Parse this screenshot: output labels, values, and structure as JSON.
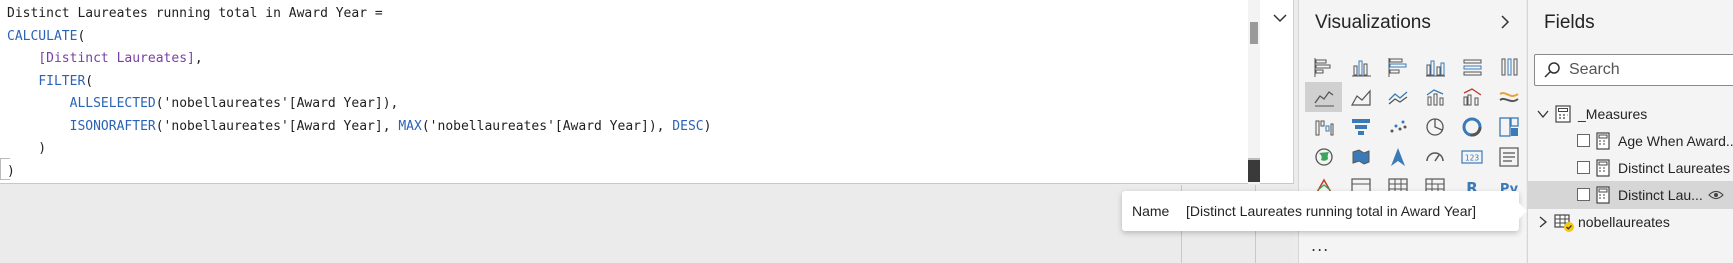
{
  "editor": {
    "lines": [
      [
        {
          "t": "Distinct Laureates running total in Award Year =",
          "c": "plain"
        }
      ],
      [
        {
          "t": "CALCULATE",
          "c": "kw"
        },
        {
          "t": "(",
          "c": "plain"
        }
      ],
      [
        {
          "t": "    ",
          "c": "plain"
        },
        {
          "t": "[Distinct Laureates]",
          "c": "ref"
        },
        {
          "t": ",",
          "c": "plain"
        }
      ],
      [
        {
          "t": "    ",
          "c": "plain"
        },
        {
          "t": "FILTER",
          "c": "kw"
        },
        {
          "t": "(",
          "c": "plain"
        }
      ],
      [
        {
          "t": "        ",
          "c": "plain"
        },
        {
          "t": "ALLSELECTED",
          "c": "kw"
        },
        {
          "t": "('nobellaureates'[Award Year]),",
          "c": "plain"
        }
      ],
      [
        {
          "t": "        ",
          "c": "plain"
        },
        {
          "t": "ISONORAFTER",
          "c": "kw"
        },
        {
          "t": "('nobellaureates'[Award Year], ",
          "c": "plain"
        },
        {
          "t": "MAX",
          "c": "kw"
        },
        {
          "t": "('nobellaureates'[Award Year]), ",
          "c": "plain"
        },
        {
          "t": "DESC",
          "c": "kw"
        },
        {
          "t": ")",
          "c": "plain"
        }
      ],
      [
        {
          "t": "    )",
          "c": "plain"
        }
      ],
      [
        {
          "t": ")",
          "c": "plain"
        }
      ]
    ]
  },
  "visualizations": {
    "title": "Visualizations",
    "more": "...",
    "icons": [
      "stacked-bar-chart-icon",
      "stacked-column-chart-icon",
      "clustered-bar-chart-icon",
      "clustered-column-chart-icon",
      "100-stacked-bar-chart-icon",
      "100-stacked-column-chart-icon",
      "line-chart-icon",
      "area-chart-icon",
      "stacked-area-chart-icon",
      "line-and-column-chart-icon",
      "line-and-clustered-column-chart-icon",
      "ribbon-chart-icon",
      "waterfall-chart-icon",
      "funnel-chart-icon",
      "scatter-chart-icon",
      "pie-chart-icon",
      "donut-chart-icon",
      "treemap-icon",
      "map-icon",
      "filled-map-icon",
      "azure-map-icon",
      "gauge-icon",
      "card-icon",
      "multi-row-card-icon",
      "kpi-icon",
      "slicer-icon",
      "table-icon",
      "matrix-icon",
      "r-script-visual-icon",
      "python-visual-icon"
    ],
    "selected_index": 6,
    "r_label": "R",
    "py_label": "Py",
    "card_label": "123"
  },
  "fields": {
    "title": "Fields",
    "search_placeholder": "Search",
    "measures_table": "_Measures",
    "items": [
      "Age When Award...",
      "Distinct Laureates",
      "Distinct Lau..."
    ],
    "data_table": "nobellaureates"
  },
  "tooltip": {
    "key": "Name",
    "value": "[Distinct Laureates running total in Award Year]"
  }
}
